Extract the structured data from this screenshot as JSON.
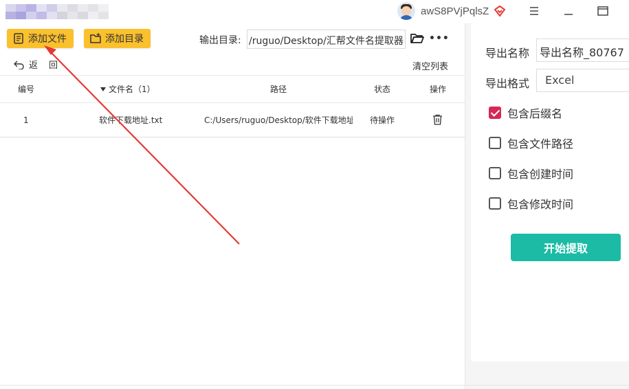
{
  "titlebar": {
    "username": "awS8PVjPqlsZ",
    "menu_icon": "hamburger-icon",
    "minimize_icon": "minimize-icon",
    "maximize_icon": "maximize-icon"
  },
  "toolbar": {
    "add_file_label": "添加文件",
    "add_dir_label": "添加目录",
    "output_dir_label": "输出目录:",
    "output_dir_value": "/ruguo/Desktop/汇帮文件名提取器",
    "more_label": "•••"
  },
  "nav": {
    "back_label_1": "返",
    "back_label_2": "回",
    "clear_list_label": "清空列表"
  },
  "table": {
    "columns": {
      "index": "编号",
      "filename": "文件名（1）",
      "path": "路径",
      "status": "状态",
      "action": "操作"
    },
    "rows": [
      {
        "index": "1",
        "filename": "软件下载地址.txt",
        "path": "C:/Users/ruguo/Desktop/软件下载地址",
        "status": "待操作"
      }
    ]
  },
  "panel": {
    "export_name_label": "导出名称",
    "export_name_value": "导出名称_80767",
    "export_format_label": "导出格式",
    "export_format_value": "Excel",
    "options": [
      {
        "label": "包含后缀名",
        "checked": true
      },
      {
        "label": "包含文件路径",
        "checked": false
      },
      {
        "label": "包含创建时间",
        "checked": false
      },
      {
        "label": "包含修改时间",
        "checked": false
      }
    ],
    "start_label": "开始提取"
  },
  "colors": {
    "accent_yellow": "#fbc02d",
    "start_button": "#1bbba5",
    "checkbox_checked": "#d6275a",
    "annotation_arrow": "#e53935"
  }
}
